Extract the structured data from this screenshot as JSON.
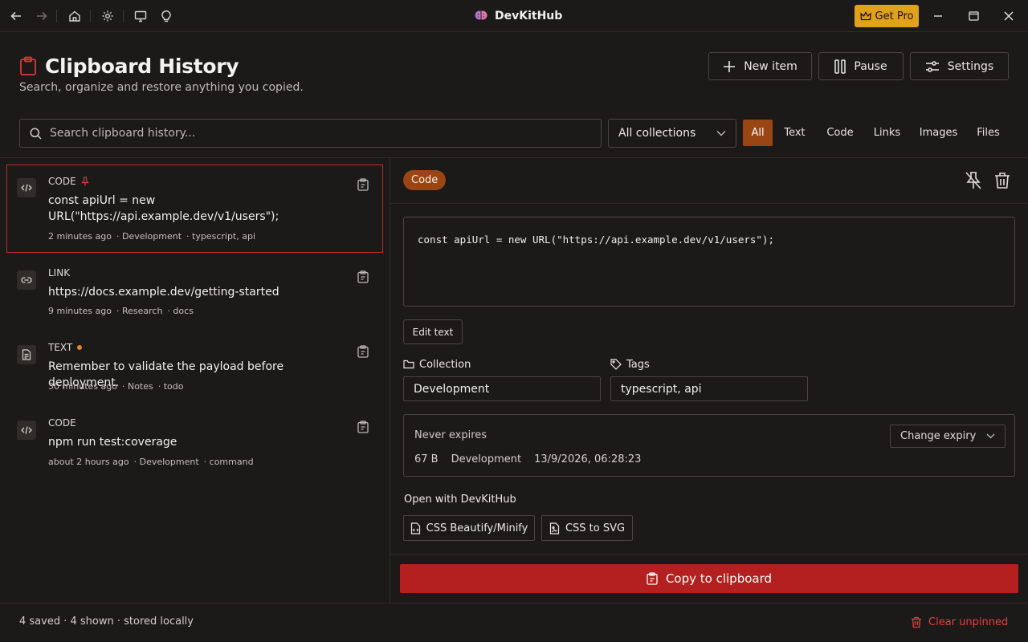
{
  "titlebar": {
    "app_name": "DevKitHub",
    "get_pro_label": "Get Pro"
  },
  "header": {
    "title": "Clipboard History",
    "subtitle": "Search, organize and restore anything you copied.",
    "new_item_label": "New item",
    "pause_label": "Pause",
    "settings_label": "Settings"
  },
  "search": {
    "placeholder": "Search clipboard history...",
    "collection_selected": "All collections"
  },
  "filters": [
    "All",
    "Text",
    "Code",
    "Links",
    "Images",
    "Files"
  ],
  "active_filter": "All",
  "items": [
    {
      "type": "CODE",
      "type_icon": "code-icon",
      "marker": "pin-icon",
      "text": "const apiUrl = new URL(\"https://api.example.dev/v1/users\");",
      "time": "2 minutes ago",
      "collection": "· Development",
      "tags": "· typescript, api",
      "selected": true
    },
    {
      "type": "LINK",
      "type_icon": "link-icon",
      "marker": "",
      "text": "https://docs.example.dev/getting-started",
      "time": "9 minutes ago",
      "collection": "· Research",
      "tags": "· docs",
      "selected": false
    },
    {
      "type": "TEXT",
      "type_icon": "document-icon",
      "marker": "dot",
      "text": "Remember to validate the payload before deployment.",
      "time": "30 minutes ago",
      "collection": "· Notes",
      "tags": "· todo",
      "selected": false
    },
    {
      "type": "CODE",
      "type_icon": "code-icon",
      "marker": "",
      "text": "npm run test:coverage",
      "time": "about 2 hours ago",
      "collection": "· Development",
      "tags": "· command",
      "selected": false
    }
  ],
  "detail": {
    "type_label": "Code",
    "content": "const apiUrl = new URL(\"https://api.example.dev/v1/users\");",
    "edit_label": "Edit text",
    "collection_label": "Collection",
    "collection_value": "Development",
    "tags_label": "Tags",
    "tags_value": "typescript, api",
    "expiry_text": "Never expires",
    "change_expiry_label": "Change expiry",
    "size": "67 B",
    "info_collection": "Development",
    "timestamp": "13/9/2026, 06:28:23",
    "open_with_label": "Open with DevKitHub",
    "tools": [
      "CSS Beautify/Minify",
      "CSS to SVG"
    ],
    "copy_label": "Copy to clipboard"
  },
  "footer": {
    "status": "4 saved · 4 shown · stored locally",
    "clear_label": "Clear unpinned"
  },
  "colors": {
    "accent_orange": "#9a4514",
    "accent_red": "#b4201f",
    "pro_yellow": "#e0a11b",
    "pin_red": "#d9393a",
    "dot_orange": "#e58a1f",
    "background": "#1c1a19"
  }
}
